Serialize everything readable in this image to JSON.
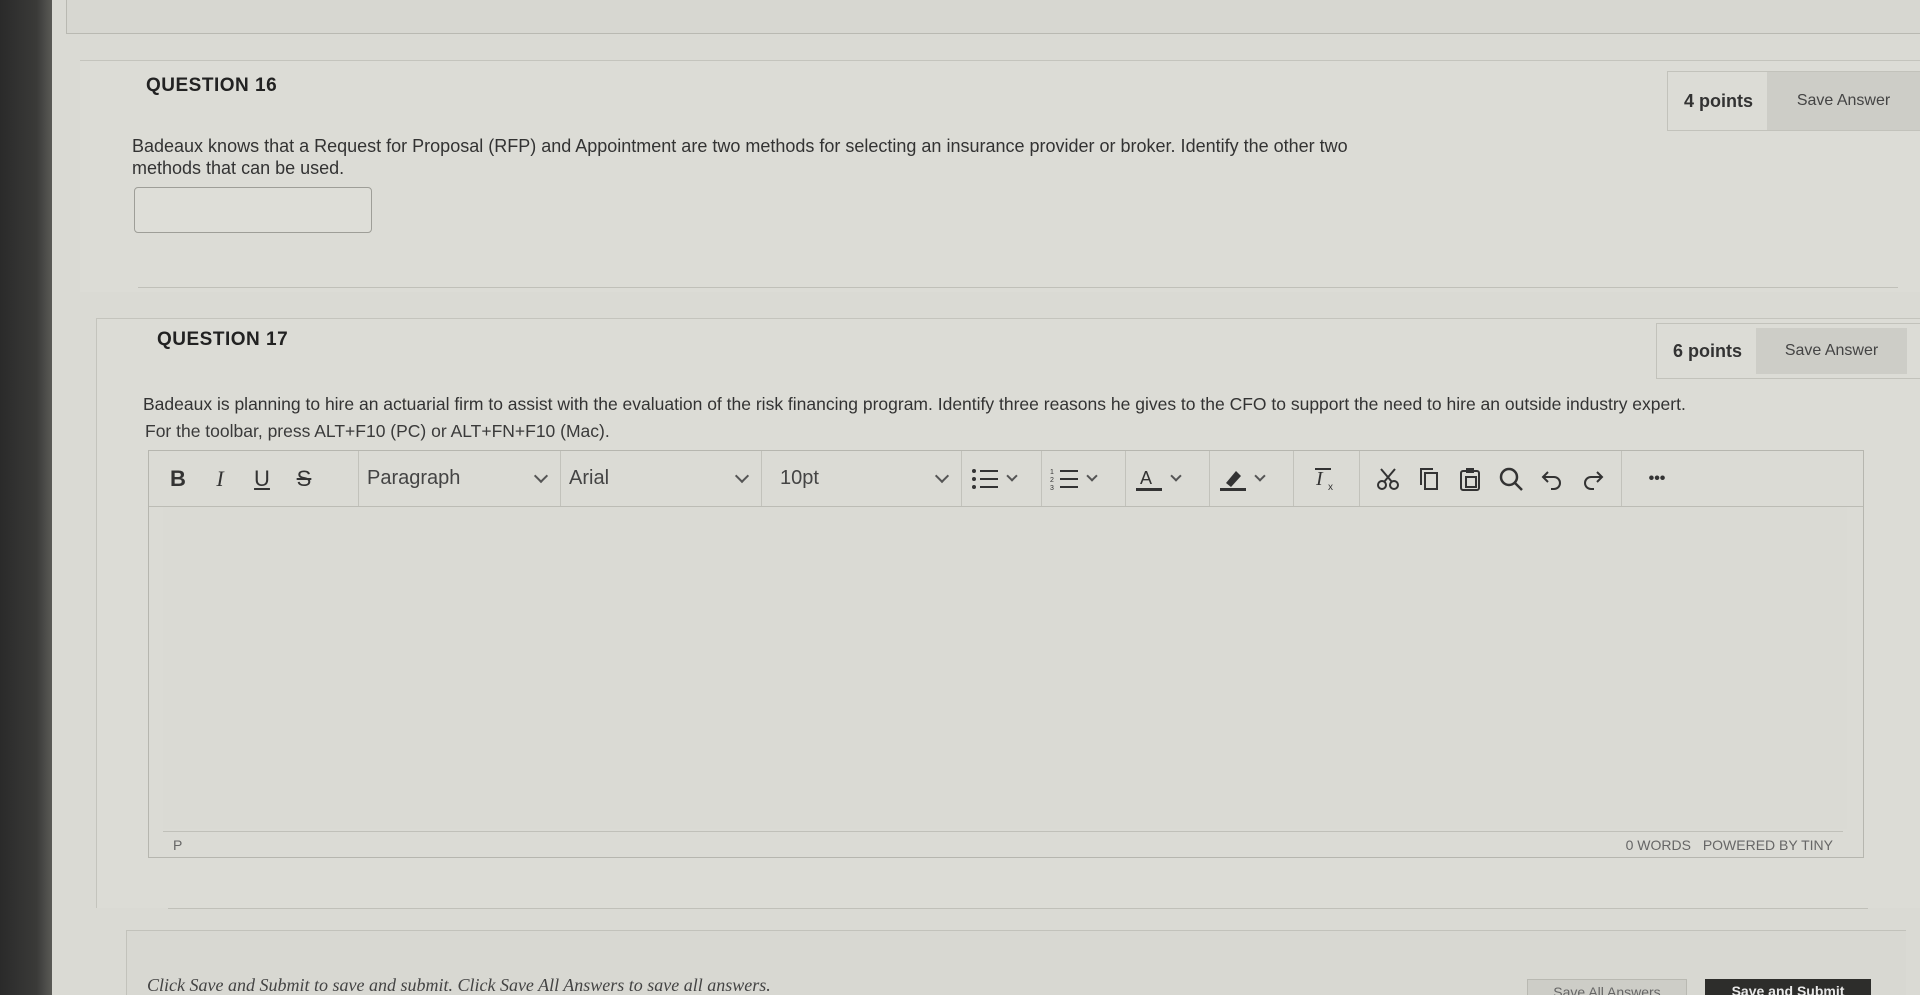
{
  "q16": {
    "title": "QUESTION 16",
    "points": "4 points",
    "save_label": "Save Answer",
    "text_line1": "Badeaux knows that a Request for Proposal (RFP) and Appointment are two methods for selecting an insurance provider or broker. Identify the other two",
    "text_line2": "methods that can be used.",
    "answer_value": ""
  },
  "q17": {
    "title": "QUESTION 17",
    "points": "6 points",
    "save_label": "Save Answer",
    "text": "Badeaux is planning to hire an actuarial firm to assist with the evaluation of the risk financing program. Identify three reasons he gives to the CFO to support the need to hire an outside industry expert.",
    "toolbar_hint": "For the toolbar, press ALT+F10 (PC) or ALT+FN+F10 (Mac)."
  },
  "editor": {
    "bold": "B",
    "italic": "I",
    "underline": "U",
    "strike": "S",
    "block_format": "Paragraph",
    "font_family": "Arial",
    "font_size": "10pt",
    "more": "•••",
    "path": "P",
    "word_count": "0 WORDS",
    "powered_by": "POWERED BY TINY",
    "icons": [
      "bold-icon",
      "italic-icon",
      "underline-icon",
      "strikethrough-icon",
      "bullet-list-icon",
      "numbered-list-icon",
      "text-color-icon",
      "highlight-icon",
      "clear-format-icon",
      "cut-icon",
      "copy-icon",
      "paste-icon",
      "search-icon",
      "undo-icon",
      "redo-icon",
      "more-icon"
    ]
  },
  "footer": {
    "instructions": "Click Save and Submit to save and submit. Click Save All Answers to save all answers.",
    "save_all_label": "Save All Answers",
    "submit_label": "Save and Submit"
  },
  "colors": {
    "page_bg": "#dadad4",
    "submit_bg": "#2d2d2b",
    "save_btn_bg": "#cdcdc7"
  }
}
